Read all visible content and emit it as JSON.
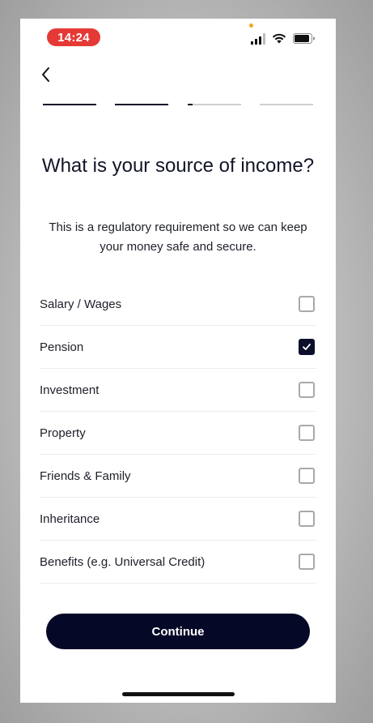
{
  "status_bar": {
    "time": "14:24",
    "icons": [
      "signal-icon",
      "wifi-icon",
      "battery-icon"
    ]
  },
  "navigation": {
    "back_icon": "chevron-left-icon"
  },
  "progress": {
    "steps": [
      {
        "fill": 1.0
      },
      {
        "fill": 1.0
      },
      {
        "fill": 0.1
      },
      {
        "fill": 0.0
      }
    ]
  },
  "heading": {
    "title": "What is your source of income?",
    "subtitle": "This is a regulatory requirement so we can keep your money safe and secure."
  },
  "options": [
    {
      "label": "Salary / Wages",
      "checked": false
    },
    {
      "label": "Pension",
      "checked": true
    },
    {
      "label": "Investment",
      "checked": false
    },
    {
      "label": "Property",
      "checked": false
    },
    {
      "label": "Friends & Family",
      "checked": false
    },
    {
      "label": "Inheritance",
      "checked": false
    },
    {
      "label": "Benefits (e.g.  Universal Credit)",
      "checked": false
    }
  ],
  "actions": {
    "continue_label": "Continue"
  },
  "colors": {
    "primary": "#050826",
    "status_time_bg": "#e53935"
  }
}
